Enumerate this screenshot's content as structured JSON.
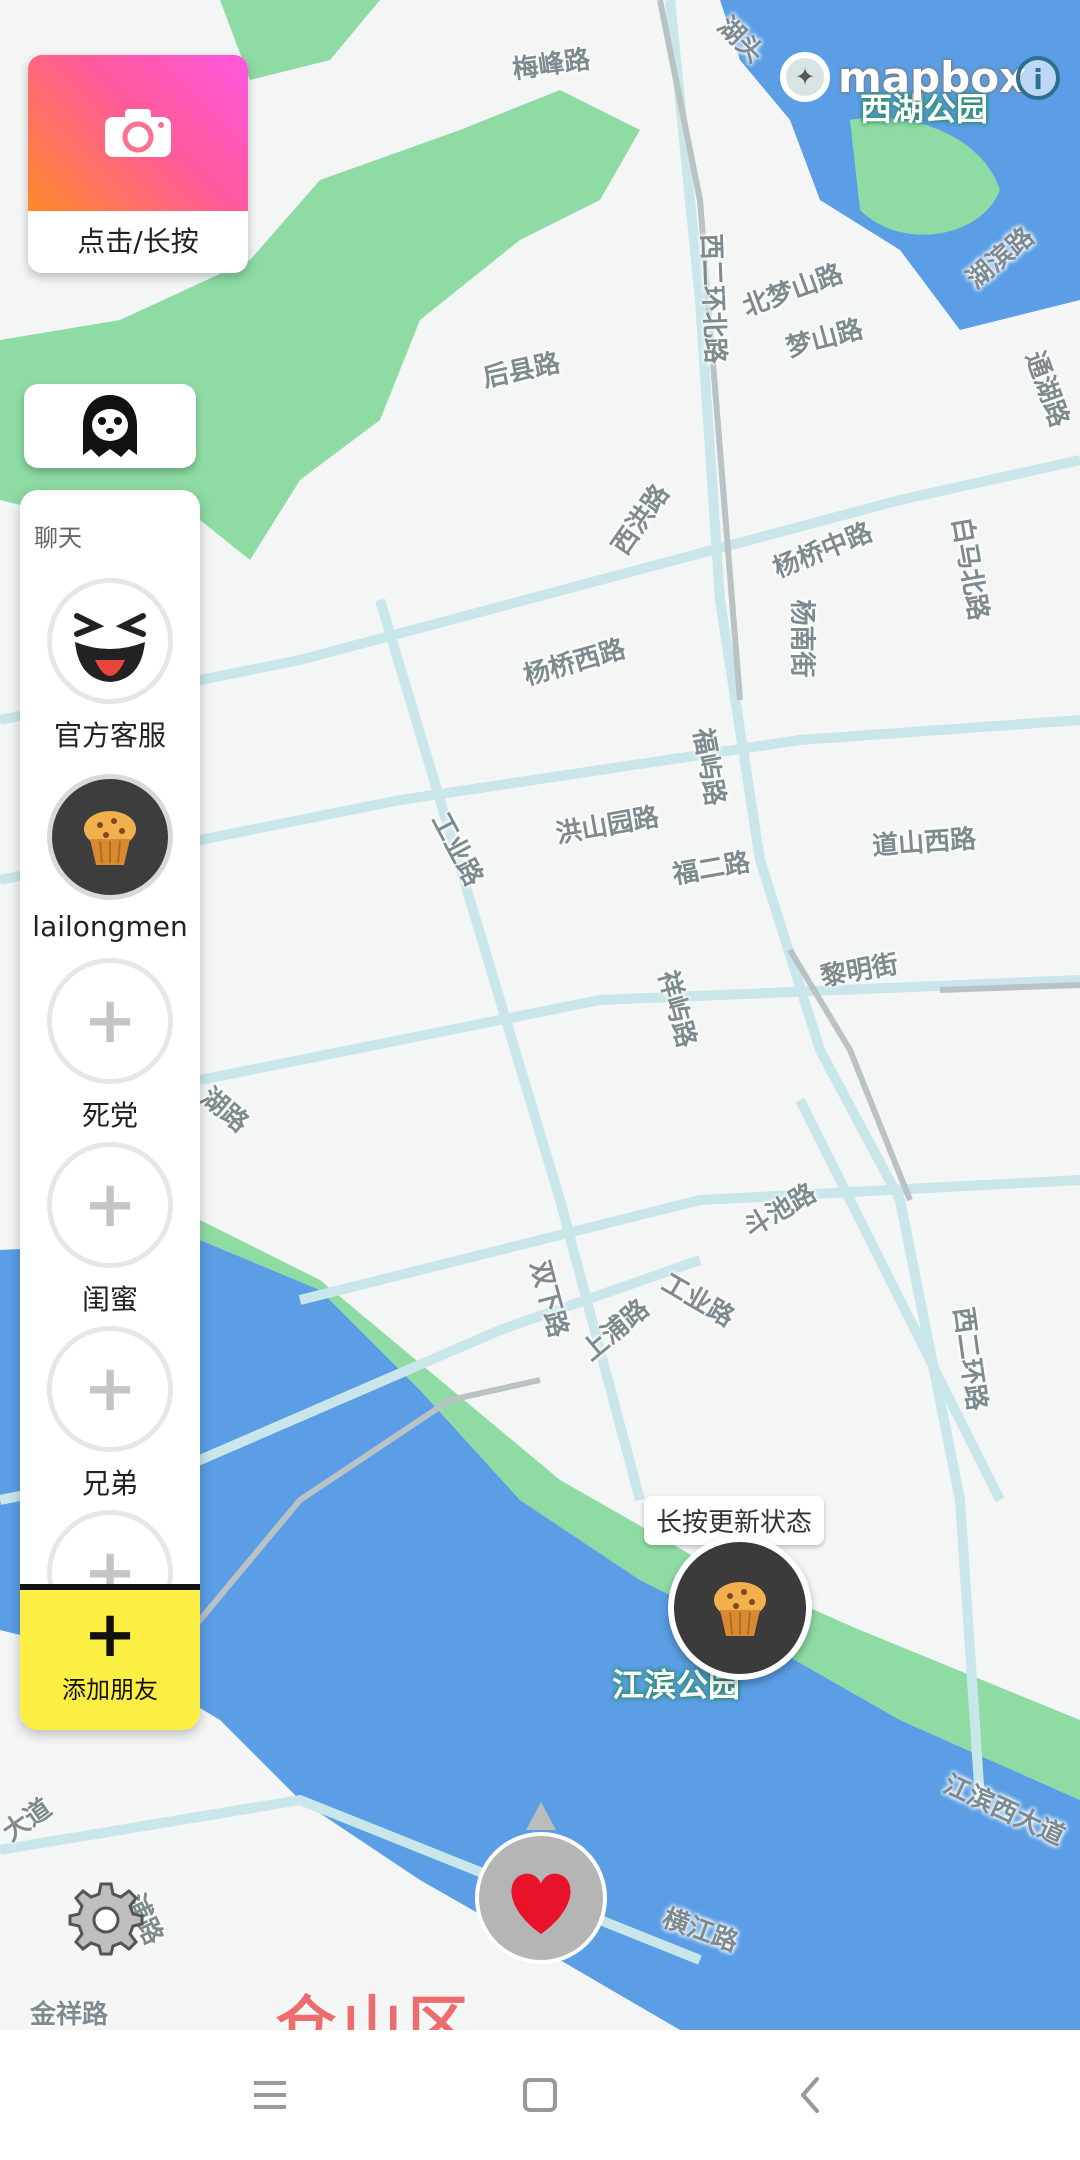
{
  "map": {
    "attribution": "mapbox",
    "park_labels": [
      "西湖公园",
      "江滨公园"
    ],
    "district_label": "仓山区",
    "road_labels": [
      "梅峰路",
      "湖头",
      "北梦山路",
      "梦山路",
      "湖滨路",
      "通湖路",
      "后县路",
      "西洪路",
      "西二环北路",
      "杨桥中路",
      "白马北路",
      "杨桥西路",
      "杨南街",
      "福屿路",
      "洪山园路",
      "道山西路",
      "工业路",
      "福二路",
      "黎明街",
      "祥屿路",
      "斗池路",
      "双下路",
      "上浦路",
      "工业路",
      "西二环路",
      "江滨西大道",
      "金祥路",
      "浦路",
      "横江路",
      "大道",
      "湖路"
    ]
  },
  "camera": {
    "label": "点击/长按",
    "icon": "camera-icon"
  },
  "ghost_button": {
    "icon": "ghost-icon"
  },
  "chat": {
    "title": "聊天",
    "friends": [
      {
        "name": "官方客服",
        "avatar": "laughing-face"
      },
      {
        "name": "lailongmen",
        "avatar": "muffin"
      },
      {
        "name": "死党",
        "avatar": "add"
      },
      {
        "name": "闺蜜",
        "avatar": "add"
      },
      {
        "name": "兄弟",
        "avatar": "add"
      }
    ],
    "add_symbol": "+",
    "add_friend_label": "添加朋友"
  },
  "status": {
    "tooltip": "长按更新状态",
    "avatar": "muffin"
  },
  "controls": {
    "settings_icon": "gear-icon",
    "heart_icon": "heart-icon"
  },
  "navbar": {
    "menu_icon": "menu-icon",
    "home_icon": "home-icon",
    "back_icon": "back-icon"
  },
  "colors": {
    "water": "#5b9ee6",
    "park": "#8edba4",
    "accent_yellow": "#fdee43",
    "road": "#c9e6ea"
  }
}
